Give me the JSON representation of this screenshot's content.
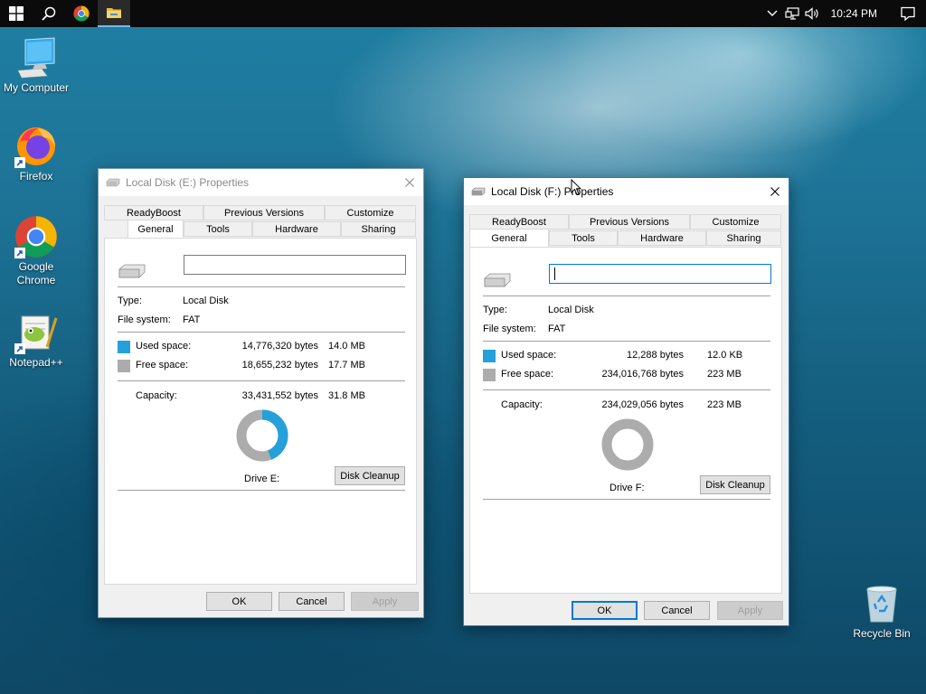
{
  "taskbar": {
    "start_icon": "windows-logo-icon",
    "search_icon": "search-icon",
    "pinned": [
      "chrome-icon",
      "file-explorer-icon"
    ],
    "tray": [
      "chevron-up-icon",
      "network-icon",
      "volume-icon"
    ],
    "clock": "10:24 PM",
    "notification_icon": "action-center-icon"
  },
  "desktop": {
    "icons": [
      {
        "label": "My Computer",
        "icon": "computer-icon"
      },
      {
        "label": "Firefox",
        "icon": "firefox-icon"
      },
      {
        "label": "Google Chrome",
        "icon": "chrome-icon"
      },
      {
        "label": "Notepad++",
        "icon": "notepad-plus-plus-icon"
      },
      {
        "label": "Recycle Bin",
        "icon": "recycle-bin-icon"
      }
    ]
  },
  "colors": {
    "used": "#26a0da",
    "free": "#acacac",
    "accent": "#0078d7"
  },
  "dialogs": [
    {
      "title": "Local Disk (E:) Properties",
      "active": false,
      "tabs_row1": [
        "ReadyBoost",
        "Previous Versions",
        "Customize"
      ],
      "tabs_row2": [
        "General",
        "Tools",
        "Hardware",
        "Sharing"
      ],
      "selected_tab": "General",
      "name_value": "",
      "type_label": "Type:",
      "type_value": "Local Disk",
      "fs_label": "File system:",
      "fs_value": "FAT",
      "used_label": "Used space:",
      "used_bytes": "14,776,320 bytes",
      "used_size": "14.0 MB",
      "free_label": "Free space:",
      "free_bytes": "18,655,232 bytes",
      "free_size": "17.7 MB",
      "capacity_label": "Capacity:",
      "capacity_bytes": "33,431,552 bytes",
      "capacity_size": "31.8 MB",
      "used_fraction": 0.442,
      "drive_label": "Drive E:",
      "cleanup_label": "Disk Cleanup",
      "ok_label": "OK",
      "cancel_label": "Cancel",
      "apply_label": "Apply"
    },
    {
      "title": "Local Disk (F:) Properties",
      "active": true,
      "tabs_row1": [
        "ReadyBoost",
        "Previous Versions",
        "Customize"
      ],
      "tabs_row2": [
        "General",
        "Tools",
        "Hardware",
        "Sharing"
      ],
      "selected_tab": "General",
      "name_value": "",
      "type_label": "Type:",
      "type_value": "Local Disk",
      "fs_label": "File system:",
      "fs_value": "FAT",
      "used_label": "Used space:",
      "used_bytes": "12,288 bytes",
      "used_size": "12.0 KB",
      "free_label": "Free space:",
      "free_bytes": "234,016,768 bytes",
      "free_size": "223 MB",
      "capacity_label": "Capacity:",
      "capacity_bytes": "234,029,056 bytes",
      "capacity_size": "223 MB",
      "used_fraction": 0.0001,
      "drive_label": "Drive F:",
      "cleanup_label": "Disk Cleanup",
      "ok_label": "OK",
      "cancel_label": "Cancel",
      "apply_label": "Apply"
    }
  ]
}
